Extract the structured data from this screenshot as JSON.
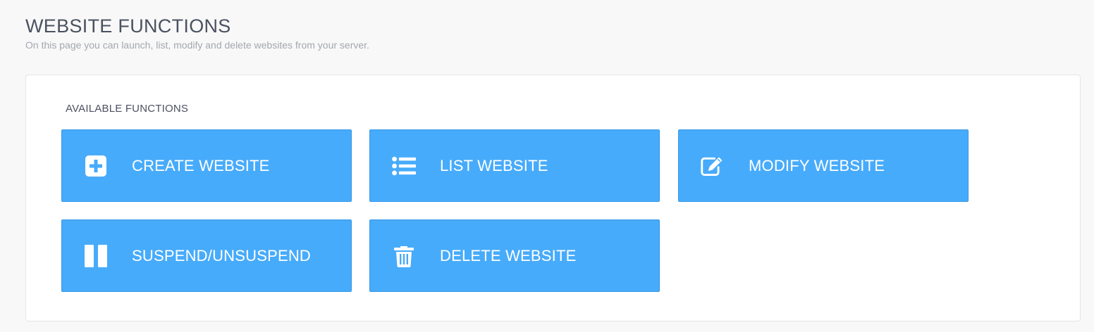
{
  "page": {
    "title": "WEBSITE FUNCTIONS",
    "subtitle": "On this page you can launch, list, modify and delete websites from your server."
  },
  "panel": {
    "heading": "AVAILABLE FUNCTIONS",
    "functions": [
      {
        "label": "CREATE WEBSITE",
        "icon": "plus-square-icon"
      },
      {
        "label": "LIST WEBSITE",
        "icon": "list-icon"
      },
      {
        "label": "MODIFY WEBSITE",
        "icon": "edit-icon"
      },
      {
        "label": "SUSPEND/UNSUSPEND",
        "icon": "pause-icon"
      },
      {
        "label": "DELETE WEBSITE",
        "icon": "trash-icon"
      }
    ]
  },
  "colors": {
    "button_background": "#47abfb",
    "button_text": "#ffffff",
    "title_text": "#4a5260",
    "subtitle_text": "#a3a7ae"
  }
}
